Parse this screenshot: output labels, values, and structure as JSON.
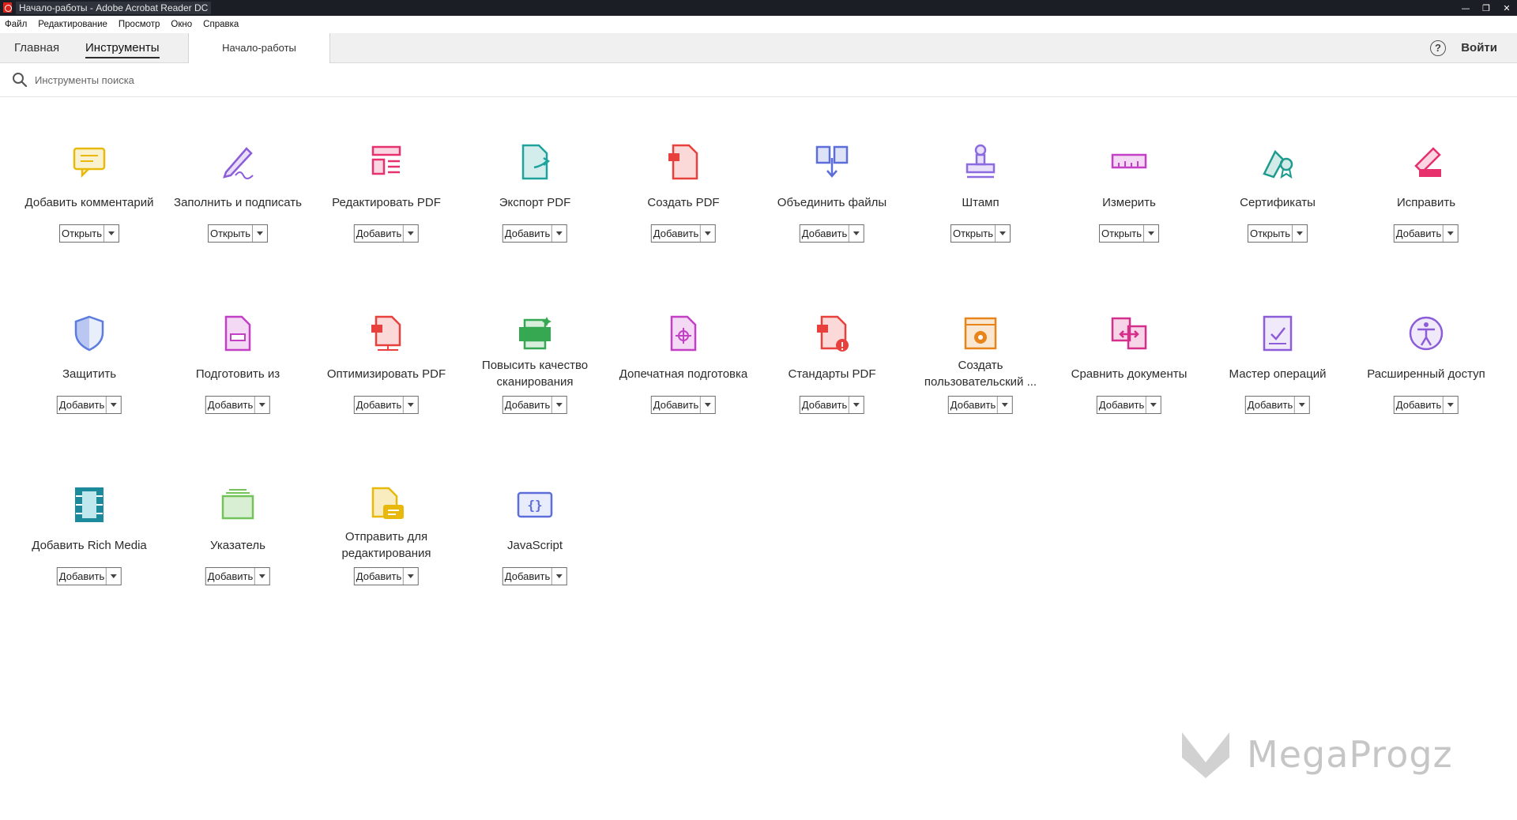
{
  "window": {
    "title": "Начало-работы - Adobe Acrobat Reader DC",
    "controls": [
      "minimize-icon",
      "restore-icon",
      "close-icon"
    ]
  },
  "menu": [
    "Файл",
    "Редактирование",
    "Просмотр",
    "Окно",
    "Справка"
  ],
  "tabs": {
    "home": "Главная",
    "tools": "Инструменты",
    "document": "Начало-работы"
  },
  "header": {
    "help_icon": "question-circle-icon",
    "signin": "Войти"
  },
  "search": {
    "placeholder": "Инструменты поиска"
  },
  "tools": [
    {
      "label": "Добавить комментарий",
      "button": "Открыть",
      "icon": "comment-icon",
      "color": "#e8b90a"
    },
    {
      "label": "Заполнить и подписать",
      "button": "Открыть",
      "icon": "fill-sign-icon",
      "color": "#8c5cd9"
    },
    {
      "label": "Редактировать PDF",
      "button": "Добавить",
      "icon": "edit-pdf-icon",
      "color": "#e6316d"
    },
    {
      "label": "Экспорт PDF",
      "button": "Добавить",
      "icon": "export-pdf-icon",
      "color": "#1da39b"
    },
    {
      "label": "Создать PDF",
      "button": "Добавить",
      "icon": "create-pdf-icon",
      "color": "#e8403c"
    },
    {
      "label": "Объединить файлы",
      "button": "Добавить",
      "icon": "combine-files-icon",
      "color": "#5c6ed9"
    },
    {
      "label": "Штамп",
      "button": "Открыть",
      "icon": "stamp-icon",
      "color": "#8c6be0"
    },
    {
      "label": "Измерить",
      "button": "Открыть",
      "icon": "measure-icon",
      "color": "#c33fc6"
    },
    {
      "label": "Сертификаты",
      "button": "Открыть",
      "icon": "certificates-icon",
      "color": "#1d9b8e"
    },
    {
      "label": "Исправить",
      "button": "Добавить",
      "icon": "redact-icon",
      "color": "#e6316d"
    },
    {
      "label": "Защитить",
      "button": "Добавить",
      "icon": "protect-icon",
      "color": "#5c7ce0"
    },
    {
      "label": "Подготовить из",
      "button": "Добавить",
      "icon": "prepare-form-icon",
      "color": "#c33fc6"
    },
    {
      "label": "Оптимизировать PDF",
      "button": "Добавить",
      "icon": "optimize-pdf-icon",
      "color": "#e8403c"
    },
    {
      "label": "Повысить качество сканирования",
      "button": "Добавить",
      "icon": "enhance-scan-icon",
      "color": "#36a852"
    },
    {
      "label": "Допечатная подготовка",
      "button": "Добавить",
      "icon": "print-production-icon",
      "color": "#c33fc6"
    },
    {
      "label": "Стандарты PDF",
      "button": "Добавить",
      "icon": "pdf-standards-icon",
      "color": "#e8403c"
    },
    {
      "label": "Создать пользовательский ...",
      "button": "Добавить",
      "icon": "custom-tool-icon",
      "color": "#e8851a"
    },
    {
      "label": "Сравнить документы",
      "button": "Добавить",
      "icon": "compare-icon",
      "color": "#d42f8a"
    },
    {
      "label": "Мастер операций",
      "button": "Добавить",
      "icon": "action-wizard-icon",
      "color": "#8c5cd9"
    },
    {
      "label": "Расширенный доступ",
      "button": "Добавить",
      "icon": "accessibility-icon",
      "color": "#8c5cd9"
    },
    {
      "label": "Добавить Rich Media",
      "button": "Добавить",
      "icon": "rich-media-icon",
      "color": "#1d8a9b"
    },
    {
      "label": "Указатель",
      "button": "Добавить",
      "icon": "index-icon",
      "color": "#72c35a"
    },
    {
      "label": "Отправить для редактирования",
      "button": "Добавить",
      "icon": "send-for-review-icon",
      "color": "#e8b90a"
    },
    {
      "label": "JavaScript",
      "button": "Добавить",
      "icon": "javascript-icon",
      "color": "#5c6ed9"
    }
  ],
  "watermark": {
    "text": "MegaProgz"
  }
}
